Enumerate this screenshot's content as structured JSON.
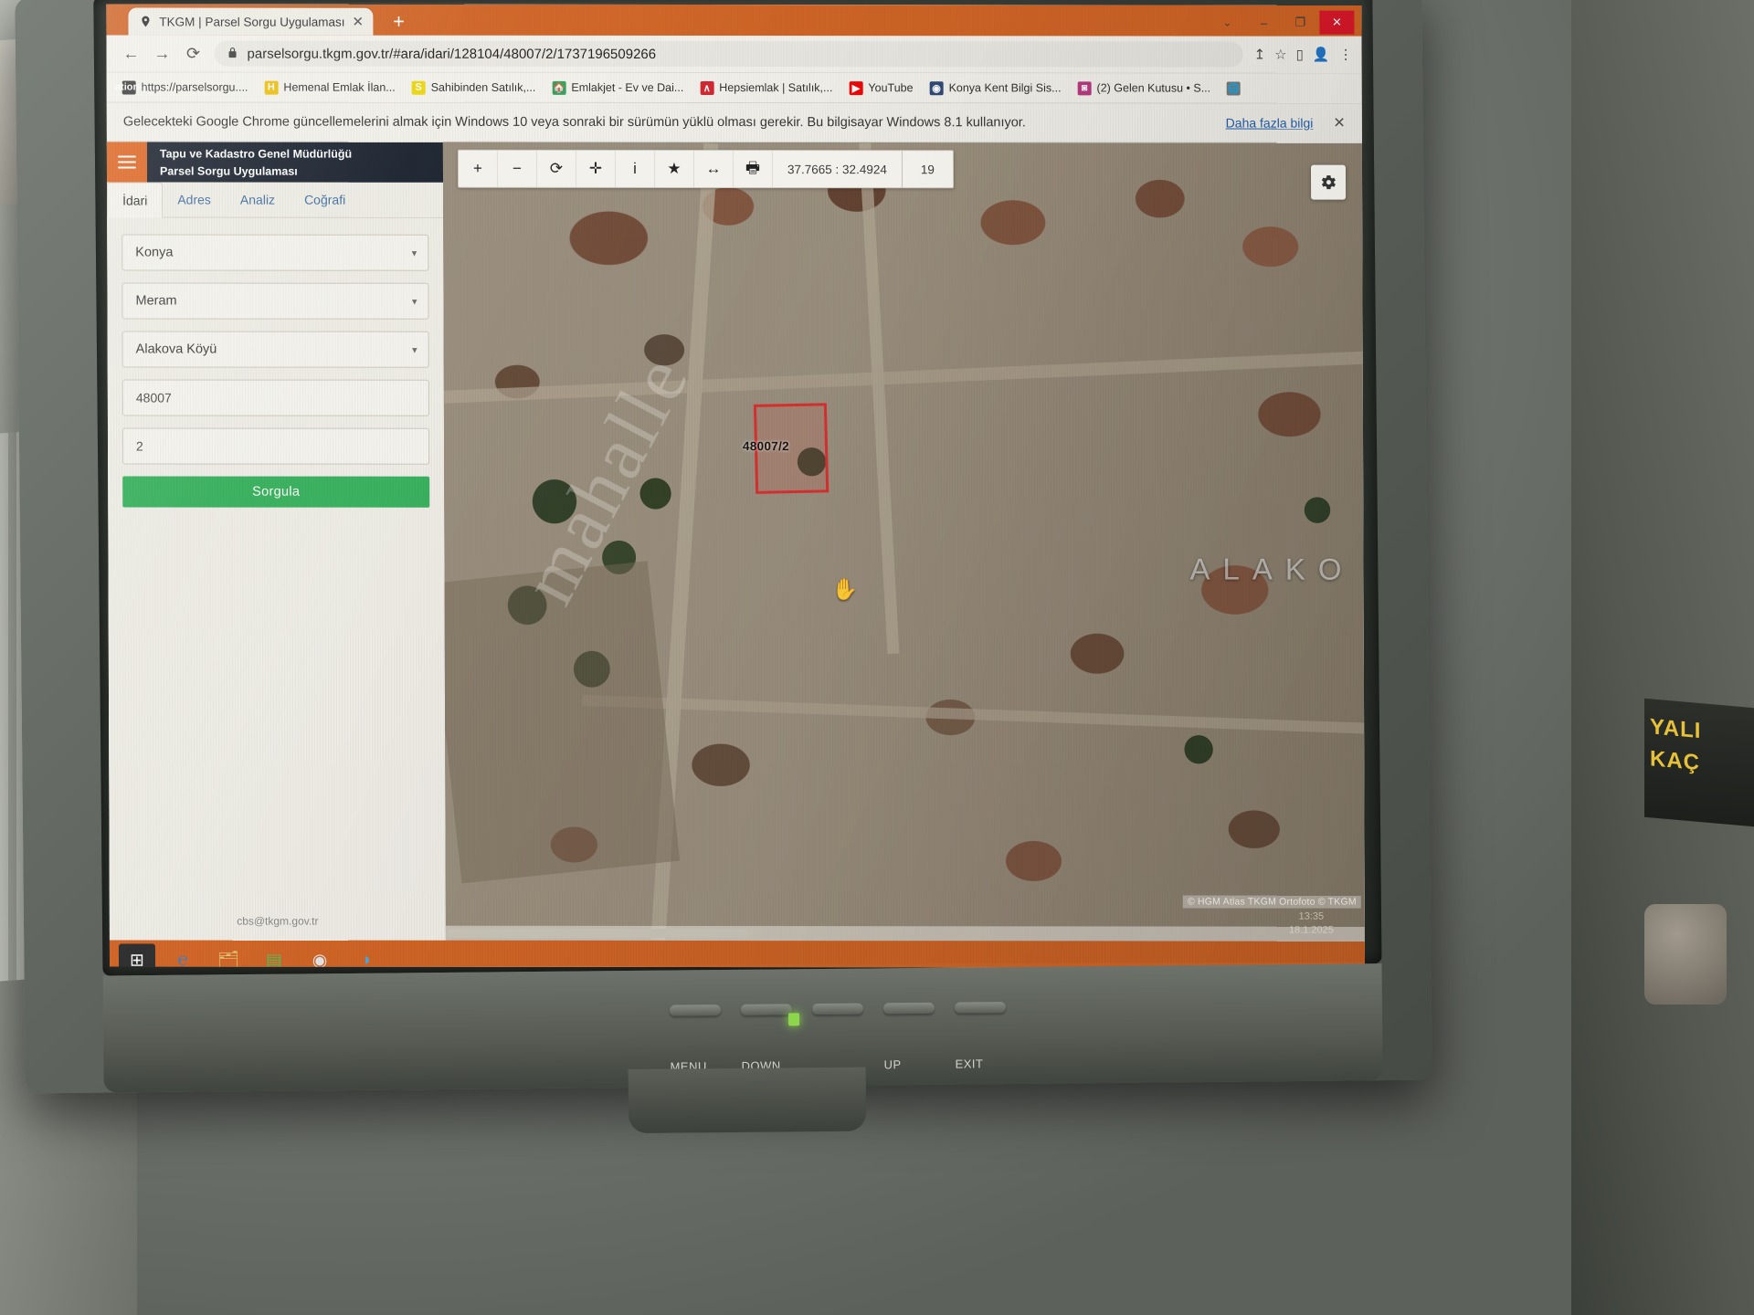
{
  "browser": {
    "tab": {
      "title": "TKGM | Parsel Sorgu Uygulaması",
      "close_label": "✕",
      "favicon_name": "location-pin-favicon"
    },
    "new_tab_label": "+",
    "window_controls": {
      "caret": "⌄",
      "minimize": "–",
      "maximize": "❐",
      "close": "✕"
    },
    "nav": {
      "back": "←",
      "forward": "→",
      "reload": "⟳"
    },
    "omnibox": {
      "lock": "🔒",
      "url": "parselsorgu.tkgm.gov.tr/#ara/idari/128104/48007/2/1737196509266"
    },
    "omnibox_actions": {
      "share": "↥",
      "bookmark": "☆",
      "sidepanel": "▯",
      "profile": "👤",
      "menu": "⋮"
    },
    "bookmarks": [
      {
        "label": "https://parselsorgu....",
        "icon": "location-pin",
        "color": "#3a3a3a"
      },
      {
        "label": "Hemenal Emlak İlan...",
        "icon": "H",
        "color": "#f2c200"
      },
      {
        "label": "Sahibinden Satılık,...",
        "icon": "S",
        "color": "#f2d900"
      },
      {
        "label": "Emlakjet - Ev ve Dai...",
        "icon": "🏠",
        "color": "#2aa65a"
      },
      {
        "label": "Hepsiemlak | Satılık,...",
        "icon": "∧",
        "color": "#e0202b"
      },
      {
        "label": "YouTube",
        "icon": "▶",
        "color": "#ff0000"
      },
      {
        "label": "Konya Kent Bilgi Sis...",
        "icon": "◉",
        "color": "#2b4a7a"
      },
      {
        "label": "(2) Gelen Kutusu • S...",
        "icon": "◙",
        "color": "#c13584"
      },
      {
        "label": "",
        "icon": "🌐",
        "color": "#7a7a7a"
      }
    ],
    "infobar": {
      "message": "Gelecekteki Google Chrome güncellemelerini almak için Windows 10 veya sonraki bir sürümün yüklü olması gerekir. Bu bilgisayar Windows 8.1 kullanıyor.",
      "link": "Daha fazla bilgi",
      "close": "✕"
    }
  },
  "app": {
    "menu_icon": "hamburger-menu",
    "title_line1": "Tapu ve Kadastro Genel Müdürlüğü",
    "title_line2": "Parsel Sorgu Uygulaması",
    "tabs": [
      {
        "label": "İdari",
        "active": true
      },
      {
        "label": "Adres",
        "active": false
      },
      {
        "label": "Analiz",
        "active": false
      },
      {
        "label": "Coğrafi",
        "active": false
      }
    ],
    "form": {
      "il": "Konya",
      "ilce": "Meram",
      "mahalle": "Alakova Köyü",
      "ada": "48007",
      "parsel": "2",
      "submit_label": "Sorgula"
    },
    "footer": "cbs@tkgm.gov.tr"
  },
  "map": {
    "toolbar": [
      {
        "name": "zoom-in-icon",
        "glyph": "+"
      },
      {
        "name": "zoom-out-icon",
        "glyph": "−"
      },
      {
        "name": "refresh-icon",
        "glyph": "⟳"
      },
      {
        "name": "pan-icon",
        "glyph": "✛"
      },
      {
        "name": "info-icon",
        "glyph": "i"
      },
      {
        "name": "favorite-icon",
        "glyph": "★"
      },
      {
        "name": "measure-icon",
        "glyph": "↔"
      },
      {
        "name": "print-icon",
        "glyph": "🖶"
      }
    ],
    "coordinates": "37.7665 : 32.4924",
    "zoom_level": "19",
    "settings_icon": "gear-icon",
    "parcel_label": "48007/2",
    "place_name": "ALAKO",
    "watermark": "mahalle",
    "cursor": "✋",
    "attribution": "© HGM Atlas  TKGM Ortofoto © TKGM",
    "stamp_time": "13:35",
    "stamp_date": "18.1.2025"
  },
  "taskbar": {
    "items": [
      {
        "name": "start-button",
        "glyph": "⊞",
        "color": "#ffffff",
        "bg": "#2a2a2a"
      },
      {
        "name": "internet-explorer-icon",
        "glyph": "℮",
        "color": "#2f7fd0",
        "bg": "transparent"
      },
      {
        "name": "file-explorer-icon",
        "glyph": "🗂",
        "color": "#e8c26a",
        "bg": "transparent"
      },
      {
        "name": "store-icon",
        "glyph": "▤",
        "color": "#4fbf4f",
        "bg": "transparent"
      },
      {
        "name": "chrome-icon",
        "glyph": "◉",
        "color": "#e8e8e8",
        "bg": "transparent"
      },
      {
        "name": "edge-icon",
        "glyph": "◑",
        "color": "#4aa6e0",
        "bg": "transparent"
      }
    ]
  },
  "monitor": {
    "buttons": [
      {
        "label": "MENU"
      },
      {
        "label": "DOWN"
      },
      {
        "label": ""
      },
      {
        "label": "UP"
      },
      {
        "label": "EXIT"
      }
    ]
  },
  "room": {
    "wall_sign_line1": "YALI",
    "wall_sign_line2": "KAÇ"
  }
}
